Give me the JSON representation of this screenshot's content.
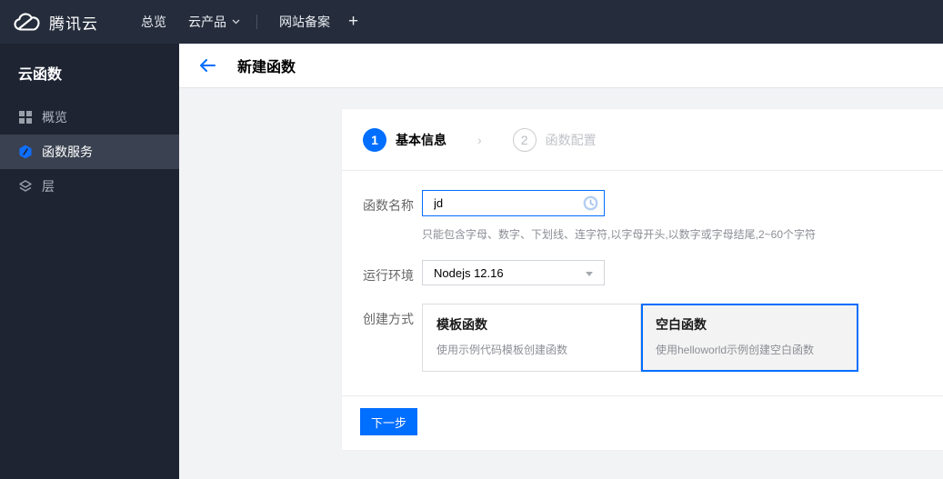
{
  "navbar": {
    "brand": "腾讯云",
    "items": [
      {
        "label": "总览"
      },
      {
        "label": "云产品",
        "caret": true
      },
      {
        "label": "网站备案"
      },
      {
        "label": "+"
      }
    ]
  },
  "sidebar": {
    "title": "云函数",
    "items": [
      {
        "label": "概览",
        "icon": "grid-icon",
        "active": false
      },
      {
        "label": "函数服务",
        "icon": "function-hexagon-icon",
        "active": true
      },
      {
        "label": "层",
        "icon": "layers-icon",
        "active": false
      }
    ]
  },
  "header": {
    "title": "新建函数"
  },
  "wizard": {
    "separator": "›",
    "steps": [
      {
        "number": "1",
        "label": "基本信息",
        "active": true
      },
      {
        "number": "2",
        "label": "函数配置",
        "active": false
      }
    ]
  },
  "form": {
    "name": {
      "label": "函数名称",
      "value": "jd",
      "help": "只能包含字母、数字、下划线、连字符,以字母开头,以数字或字母结尾,2~60个字符",
      "status_icon": "clock-icon"
    },
    "runtime": {
      "label": "运行环境",
      "value": "Nodejs 12.16"
    },
    "method": {
      "label": "创建方式",
      "options": [
        {
          "title": "模板函数",
          "desc": "使用示例代码模板创建函数",
          "selected": false
        },
        {
          "title": "空白函数",
          "desc": "使用helloworld示例创建空白函数",
          "selected": true
        }
      ]
    },
    "next_label": "下一步"
  },
  "colors": {
    "accent": "#006eff",
    "navbar_bg": "#252d3c",
    "sidebar_bg": "#1e2432",
    "sidebar_active_bg": "#3a4150",
    "content_bg": "#f2f3f5",
    "selected_card_bg": "#f3f3f3"
  }
}
